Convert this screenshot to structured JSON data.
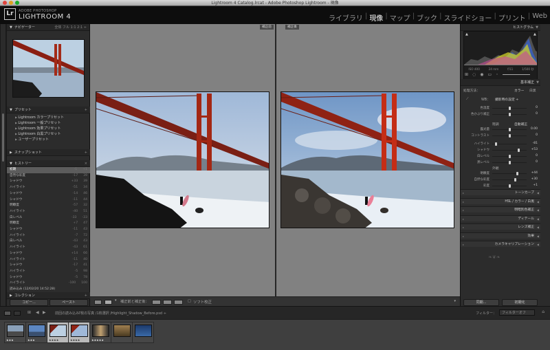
{
  "window_title": "Lightroom 4 Catalog.lrcat - Adobe Photoshop Lightroom - 現像",
  "brand": {
    "top": "ADOBE PHOTOSHOP",
    "name": "LIGHTROOM 4",
    "logo": "Lr"
  },
  "modules": [
    {
      "label": "ライブラリ",
      "active": false
    },
    {
      "label": "現像",
      "active": true
    },
    {
      "label": "マップ",
      "active": false
    },
    {
      "label": "ブック",
      "active": false
    },
    {
      "label": "スライドショー",
      "active": false
    },
    {
      "label": "プリント",
      "active": false
    },
    {
      "label": "Web",
      "active": false
    }
  ],
  "navigator": {
    "title": "ナビゲーター",
    "zoom": "全体  フル  1:1  2:1 ÷"
  },
  "presets": {
    "title": "プリセット",
    "items": [
      "Lightroom カラープリセット",
      "Lightroom 一般プリセット",
      "Lightroom 効果プリセット",
      "Lightroom 白黒プリセット",
      "ユーザープリセット"
    ]
  },
  "snapshots": {
    "title": "スナップショット"
  },
  "history": {
    "title": "ヒストリー",
    "rows": [
      {
        "label": "初期",
        "a": "-1",
        "b": "+1",
        "sel": true
      },
      {
        "label": "自然な彩度",
        "a": "-17",
        "b": "39"
      },
      {
        "label": "シャドウ",
        "a": "+33",
        "b": "39"
      },
      {
        "label": "ハイライト",
        "a": "-51",
        "b": "34"
      },
      {
        "label": "シャドウ",
        "a": "-14",
        "b": "46"
      },
      {
        "label": "シャドウ",
        "a": "-11",
        "b": "44"
      },
      {
        "label": "明瞭度",
        "a": "-57",
        "b": "32"
      },
      {
        "label": "ハイライト",
        "a": "-40",
        "b": "51"
      },
      {
        "label": "白レベル",
        "a": "-33",
        "b": "-33"
      },
      {
        "label": "明瞭度",
        "a": "+7",
        "b": "47"
      },
      {
        "label": "シャドウ",
        "a": "-11",
        "b": "43"
      },
      {
        "label": "ハイライト",
        "a": "-7",
        "b": "72"
      },
      {
        "label": "白レベル",
        "a": "-43",
        "b": "43"
      },
      {
        "label": "ハイライト",
        "a": "-43",
        "b": "61"
      },
      {
        "label": "シャドウ",
        "a": "+14",
        "b": "66"
      },
      {
        "label": "ハイライト",
        "a": "-11",
        "b": "40"
      },
      {
        "label": "シャドウ",
        "a": "-17",
        "b": "41"
      },
      {
        "label": "ハイライト",
        "a": "-5",
        "b": "98"
      },
      {
        "label": "シャドウ",
        "a": "-5",
        "b": "78"
      },
      {
        "label": "ハイライト",
        "a": "-100",
        "b": "100"
      },
      {
        "label": "読み込み (12/02/20 14:52:28)",
        "a": "",
        "b": ""
      }
    ]
  },
  "collections": {
    "title": "コレクション"
  },
  "left_buttons": {
    "copy": "コピー...",
    "paste": "ペースト"
  },
  "view_labels": {
    "before": "補正前",
    "after": "補正後"
  },
  "toolbar": {
    "compare_label": "補正前と補正後：",
    "soft_proof": "ソフト校正"
  },
  "histogram_panel": {
    "title": "ヒストグラム",
    "info": [
      "ISO 400",
      "24 mm",
      "f/11",
      "1/500 秒"
    ]
  },
  "basic": {
    "title": "基本補正",
    "treatment_label": "処理方法：",
    "treatment_color": "カラー",
    "treatment_bw": "白黒",
    "wb_label": "WB：",
    "wb_value": "撮影時の設定 ÷",
    "tone_label": "階調",
    "auto_label": "自動補正",
    "presence_label": "外観",
    "sliders": [
      {
        "label": "色温度",
        "value": "0",
        "pos": 0.5
      },
      {
        "label": "色かぶり補正",
        "value": "0",
        "pos": 0.5
      },
      {
        "label": "露光量",
        "value": "0.00",
        "pos": 0.5
      },
      {
        "label": "コントラスト",
        "value": "0",
        "pos": 0.5
      },
      {
        "label": "ハイライト",
        "value": "-81",
        "pos": 0.1
      },
      {
        "label": "シャドウ",
        "value": "+53",
        "pos": 0.76
      },
      {
        "label": "白レベル",
        "value": "0",
        "pos": 0.5
      },
      {
        "label": "黒レベル",
        "value": "0",
        "pos": 0.5
      },
      {
        "label": "明瞭度",
        "value": "+44",
        "pos": 0.72
      },
      {
        "label": "自然な彩度",
        "value": "+30",
        "pos": 0.65
      },
      {
        "label": "彩度",
        "value": "+1",
        "pos": 0.5
      }
    ]
  },
  "right_sections": [
    "トーンカーブ",
    "HSL / カラー / 白黒",
    "明暗別色補正",
    "ディテール",
    "レンズ補正",
    "効果",
    "カメラキャリブレーション"
  ],
  "right_buttons": {
    "sync": "同期...",
    "reset": "初期化"
  },
  "filmbar": {
    "source": "前回の読み込み",
    "info": "7枚の写真 /1枚選択 /Highlight_Shadow_Before.psd ÷",
    "filter_label": "フィルター：",
    "filter_value": "フィルターオフ"
  },
  "filmstrip": [
    {
      "stars": "★★★",
      "selected": false
    },
    {
      "stars": "★★★",
      "selected": false
    },
    {
      "stars": "★★★★",
      "selected": true
    },
    {
      "stars": "★★★★",
      "selected": true
    },
    {
      "stars": "★★★★★",
      "selected": false
    },
    {
      "stars": "",
      "selected": false
    },
    {
      "stars": "",
      "selected": false
    }
  ],
  "colors": {
    "accent": "#ffffff",
    "panel": "#2c2c2c",
    "center": "#818181"
  }
}
